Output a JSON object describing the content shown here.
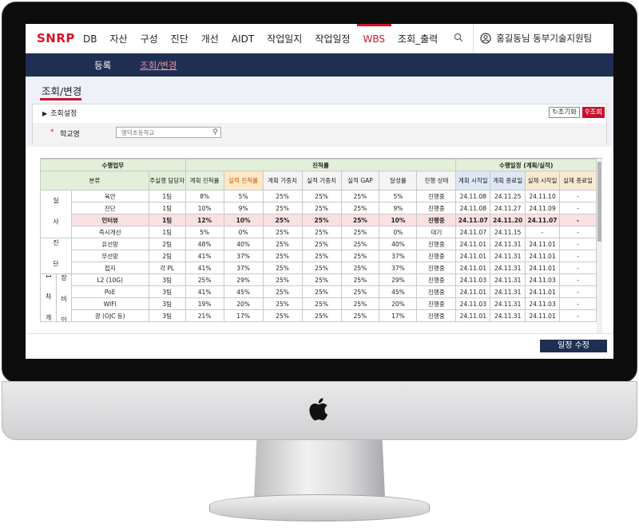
{
  "nav": {
    "logo": "SNRP",
    "items": [
      "DB",
      "자산",
      "구성",
      "진단",
      "개선",
      "AIDT",
      "작업일지",
      "작업일정",
      "WBS",
      "조회_출력"
    ],
    "active": "WBS",
    "user": "홍길동님 동부기술지원팀"
  },
  "subnav": {
    "items": [
      "등록",
      "조회/변경"
    ],
    "active": "조회/변경"
  },
  "page": {
    "title": "조회/변경"
  },
  "filter": {
    "settings_label": "조회설정",
    "reset_label": "초기화",
    "search_label": "조회",
    "required_mark": "*",
    "school_label": "학교명",
    "school_value": "명덕초등학교"
  },
  "table": {
    "group_headers": {
      "task": "수행업무",
      "progress": "진척률",
      "schedule": "수행일정 (계획/실적)"
    },
    "col_headers": {
      "category": "분류",
      "owner": "주실행 담당자",
      "plan_prog": "계획 진척률",
      "act_prog": "실적 진척률",
      "plan_wgt": "계획 가중치",
      "act_wgt": "실적 가중치",
      "gap": "실적 GAP",
      "achieve": "달성률",
      "status": "진행 상태",
      "plan_start": "계획 시작일",
      "plan_end": "계획 종료일",
      "act_start": "실제 시작일",
      "act_end": "실제 종료일"
    },
    "groups": {
      "g1": "실 사",
      "g2": "진 단",
      "g3": "1 차 개 선",
      "g3_sub": "장 비 인 수"
    },
    "rows": [
      {
        "name": "육안",
        "owner": "1팀",
        "pp": "8%",
        "ap": "5%",
        "pw": "25%",
        "aw": "25%",
        "gap": "25%",
        "ach": "5%",
        "st": "진행중",
        "ps": "24.11.08",
        "pe": "24.11.25",
        "as": "24.11.10",
        "ae": "-"
      },
      {
        "name": "진단",
        "owner": "1팀",
        "pp": "10%",
        "ap": "9%",
        "pw": "25%",
        "aw": "25%",
        "gap": "25%",
        "ach": "9%",
        "st": "진행중",
        "ps": "24.11.08",
        "pe": "24.11.27",
        "as": "24.11.09",
        "ae": "-"
      },
      {
        "name": "인터뷰",
        "owner": "1팀",
        "pp": "12%",
        "ap": "10%",
        "pw": "25%",
        "aw": "25%",
        "gap": "25%",
        "ach": "10%",
        "st": "진행중",
        "ps": "24.11.07",
        "pe": "24.11.20",
        "as": "24.11.07",
        "ae": "-"
      },
      {
        "name": "즉시개선",
        "owner": "1팀",
        "pp": "5%",
        "ap": "0%",
        "pw": "25%",
        "aw": "25%",
        "gap": "25%",
        "ach": "0%",
        "st": "대기",
        "ps": "24.11.07",
        "pe": "24.11.15",
        "as": "-",
        "ae": "-"
      },
      {
        "name": "유선망",
        "owner": "2팀",
        "pp": "48%",
        "ap": "40%",
        "pw": "25%",
        "aw": "25%",
        "gap": "25%",
        "ach": "40%",
        "st": "진행중",
        "ps": "24.11.01",
        "pe": "24.11.31",
        "as": "24.11.01",
        "ae": "-"
      },
      {
        "name": "무선망",
        "owner": "2팀",
        "pp": "41%",
        "ap": "37%",
        "pw": "25%",
        "aw": "25%",
        "gap": "25%",
        "ach": "37%",
        "st": "진행중",
        "ps": "24.11.01",
        "pe": "24.11.31",
        "as": "24.11.01",
        "ae": "-"
      },
      {
        "name": "접지",
        "owner": "각 PL",
        "pp": "41%",
        "ap": "37%",
        "pw": "25%",
        "aw": "25%",
        "gap": "25%",
        "ach": "37%",
        "st": "진행중",
        "ps": "24.11.01",
        "pe": "24.11.31",
        "as": "24.11.01",
        "ae": "-"
      },
      {
        "name": "L2 (10G)",
        "owner": "3팀",
        "pp": "25%",
        "ap": "29%",
        "pw": "25%",
        "aw": "25%",
        "gap": "25%",
        "ach": "29%",
        "st": "진행중",
        "ps": "24.11.03",
        "pe": "24.11.31",
        "as": "24.11.03",
        "ae": "-"
      },
      {
        "name": "PoE",
        "owner": "3팀",
        "pp": "41%",
        "ap": "45%",
        "pw": "25%",
        "aw": "25%",
        "gap": "25%",
        "ach": "45%",
        "st": "진행중",
        "ps": "24.11.01",
        "pe": "24.11.31",
        "as": "24.11.01",
        "ae": "-"
      },
      {
        "name": "WIFI",
        "owner": "3팀",
        "pp": "19%",
        "ap": "20%",
        "pw": "25%",
        "aw": "25%",
        "gap": "25%",
        "ach": "20%",
        "st": "진행중",
        "ps": "24.11.03",
        "pe": "24.11.31",
        "as": "24.11.03",
        "ae": "-"
      },
      {
        "name": "광 (OJC 등)",
        "owner": "3팀",
        "pp": "21%",
        "ap": "17%",
        "pw": "25%",
        "aw": "25%",
        "gap": "25%",
        "ach": "17%",
        "st": "진행중",
        "ps": "24.11.01",
        "pe": "24.11.31",
        "as": "24.11.01",
        "ae": "-"
      }
    ]
  },
  "footer": {
    "edit_label": "일정 수정"
  },
  "colors": {
    "brand_red": "#d6122c",
    "navy": "#1f2f52",
    "highlight_row": "#fbe0e3"
  }
}
